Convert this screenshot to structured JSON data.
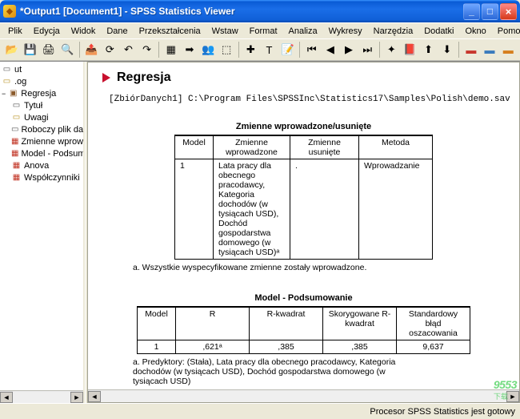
{
  "window": {
    "title": "*Output1 [Document1] - SPSS Statistics Viewer"
  },
  "menu": {
    "items": [
      "Plik",
      "Edycja",
      "Widok",
      "Dane",
      "Przekształcenia",
      "Wstaw",
      "Format",
      "Analiza",
      "Wykresy",
      "Narzędzia",
      "Dodatki",
      "Okno",
      "Pomoc"
    ]
  },
  "outline": {
    "items": [
      {
        "label": "ut",
        "icon": "page"
      },
      {
        "label": ".og",
        "icon": "note"
      },
      {
        "label": "Regresja",
        "icon": "book"
      },
      {
        "label": "Tytuł",
        "icon": "page",
        "indent": 1
      },
      {
        "label": "Uwagi",
        "icon": "note",
        "indent": 1
      },
      {
        "label": "Roboczy plik dany",
        "icon": "page",
        "indent": 1
      },
      {
        "label": "Zmienne wprowa",
        "icon": "chart",
        "indent": 1
      },
      {
        "label": "Model - Podsumo",
        "icon": "chart",
        "indent": 1
      },
      {
        "label": "Anova",
        "icon": "chart",
        "indent": 1
      },
      {
        "label": "Współczynniki",
        "icon": "chart",
        "indent": 1
      }
    ]
  },
  "doc": {
    "heading": "Regresja",
    "dataset": "[ZbiórDanych1] C:\\Program Files\\SPSSInc\\Statistics17\\Samples\\Polish\\demo.sav",
    "table1": {
      "title": "Zmienne wprowadzone/usunięte",
      "cols": [
        "Model",
        "Zmienne wprowadzone",
        "Zmienne usunięte",
        "Metoda"
      ],
      "row": {
        "model": "1",
        "entered": "Lata pracy dla obecnego pracodawcy, Kategoria dochodów (w tysiącach USD), Dochód gospodarstwa domowego (w tysiącach USD)ᵃ",
        "removed": ".",
        "method": "Wprowadzanie"
      },
      "footnote": "a. Wszystkie wyspecyfikowane zmienne zostały wprowadzone."
    },
    "table2": {
      "title": "Model - Podsumowanie",
      "cols": [
        "Model",
        "R",
        "R-kwadrat",
        "Skorygowane R-kwadrat",
        "Standardowy błąd oszacowania"
      ],
      "row": {
        "model": "1",
        "r": ",621ᵃ",
        "r2": ",385",
        "adjr2": ",385",
        "se": "9,637"
      },
      "footnote": "a. Predyktory: (Stała), Lata pracy dla obecnego pracodawcy, Kategoria dochodów (w tysiącach USD), Dochód gospodarstwa domowego (w tysiącach USD)"
    }
  },
  "status": {
    "text": "Procesor SPSS Statistics  jest gotowy"
  },
  "watermark": {
    "big": "9553",
    "small": "下载"
  }
}
